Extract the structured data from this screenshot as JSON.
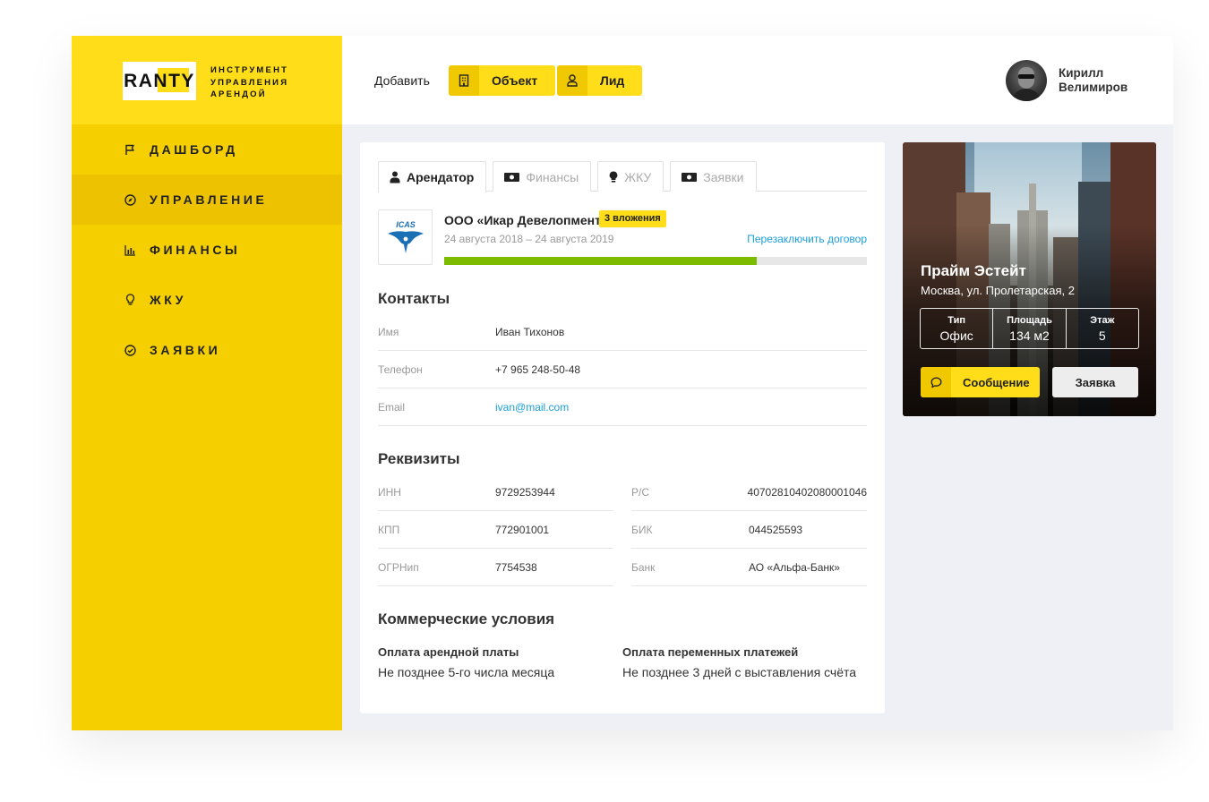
{
  "brand": {
    "logo_text": "RANTY",
    "tagline_lines": [
      "ИНСТРУМЕНТ",
      "УПРАВЛЕНИЯ",
      "АРЕНДОЙ"
    ],
    "accent": "#ffdd19"
  },
  "sidebar": {
    "items": [
      {
        "label": "ДАШБОРД",
        "icon": "flag-icon"
      },
      {
        "label": "УПРАВЛЕНИЕ",
        "icon": "compass-icon",
        "active": true
      },
      {
        "label": "ФИНАНСЫ",
        "icon": "bar-chart-icon"
      },
      {
        "label": "ЖКУ",
        "icon": "lightbulb-icon"
      },
      {
        "label": "ЗАЯВКИ",
        "icon": "check-circle-icon"
      }
    ]
  },
  "header": {
    "add_label": "Добавить",
    "object_button": "Объект",
    "lead_button": "Лид",
    "user_first": "Кирилл",
    "user_last": "Велимиров"
  },
  "tabs": [
    {
      "label": "Арендатор",
      "icon": "person-icon",
      "active": true
    },
    {
      "label": "Финансы",
      "icon": "banknote-icon"
    },
    {
      "label": "ЖКУ",
      "icon": "lightbulb-icon"
    },
    {
      "label": "Заявки",
      "icon": "banknote-icon"
    }
  ],
  "tenant": {
    "logo_text": "ICAS",
    "name": "ООО «Икар Девелопмент»",
    "badge": "3 вложения",
    "dates": "24 августа 2018 – 24 августа 2019",
    "renew_link": "Перезаключить договор",
    "progress": 0.74,
    "progress_color": "#7dbb00"
  },
  "contacts": {
    "title": "Контакты",
    "rows": [
      {
        "key": "Имя",
        "value": "Иван Тихонов"
      },
      {
        "key": "Телефон",
        "value": "+7 965 248-50-48"
      },
      {
        "key": "Email",
        "value": "ivan@mail.com"
      }
    ]
  },
  "requisites": {
    "title": "Реквизиты",
    "left": [
      {
        "key": "ИНН",
        "value": "9729253944"
      },
      {
        "key": "КПП",
        "value": "772901001"
      },
      {
        "key": "ОГРНип",
        "value": "7754538"
      }
    ],
    "right": [
      {
        "key": "Р/С",
        "value": "40702810402080001046"
      },
      {
        "key": "БИК",
        "value": "044525593"
      },
      {
        "key": "Банк",
        "value": "АО «Альфа-Банк»"
      }
    ]
  },
  "commercial": {
    "title": "Коммерческие условия",
    "rent_title": "Оплата арендной платы",
    "rent_value": "Не позднее 5-го числа месяца",
    "var_title": "Оплата переменных платежей",
    "var_value": "Не позднее 3 дней с выставления счёта"
  },
  "property": {
    "title": "Прайм Эстейт",
    "address": "Москва, ул. Пролетарская, 2",
    "specs": [
      {
        "key": "Тип",
        "value": "Офис"
      },
      {
        "key": "Площадь",
        "value": "134 м2"
      },
      {
        "key": "Этаж",
        "value": "5"
      }
    ],
    "message_button": "Сообщение",
    "request_button": "Заявка"
  }
}
